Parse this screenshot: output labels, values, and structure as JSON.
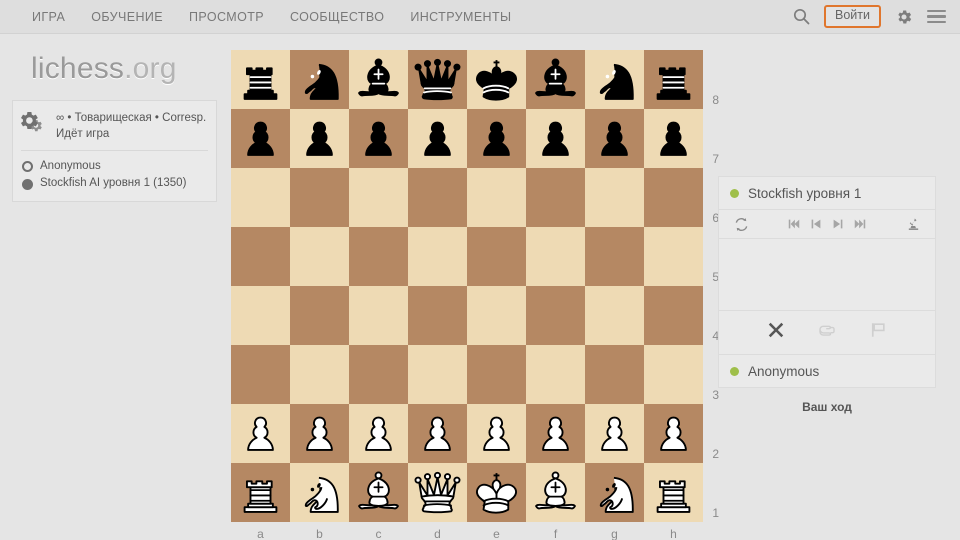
{
  "header": {
    "nav": [
      {
        "label": "ИГРА",
        "name": "nav-play"
      },
      {
        "label": "ОБУЧЕНИЕ",
        "name": "nav-learn"
      },
      {
        "label": "ПРОСМОТР",
        "name": "nav-watch"
      },
      {
        "label": "СООБЩЕСТВО",
        "name": "nav-community"
      },
      {
        "label": "ИНСТРУМЕНТЫ",
        "name": "nav-tools"
      }
    ],
    "search_icon": "search-icon",
    "signin_label": "Войти",
    "gear_icon": "gear-icon",
    "menu_icon": "hamburger-menu-icon",
    "accent_color": "#e0762d",
    "background": "#dedede"
  },
  "logo": {
    "text_main": "lichess",
    "text_dim": ".org"
  },
  "game_info": {
    "gears_icon": "gears-icon",
    "meta_line": "∞ • Товарищеская • Corresp.",
    "status_line": "Идёт игра",
    "players": [
      {
        "name": "Anonymous",
        "color": "white"
      },
      {
        "name": "Stockfish AI уровня 1 (1350)",
        "color": "black"
      }
    ]
  },
  "board": {
    "light_color": "#eedab4",
    "dark_color": "#b58863",
    "files": [
      "a",
      "b",
      "c",
      "d",
      "e",
      "f",
      "g",
      "h"
    ],
    "ranks": [
      "8",
      "7",
      "6",
      "5",
      "4",
      "3",
      "2",
      "1"
    ],
    "orientation": "white",
    "position": [
      [
        "r",
        "n",
        "b",
        "q",
        "k",
        "b",
        "n",
        "r"
      ],
      [
        "p",
        "p",
        "p",
        "p",
        "p",
        "p",
        "p",
        "p"
      ],
      [
        "",
        "",
        "",
        "",
        "",
        "",
        "",
        ""
      ],
      [
        "",
        "",
        "",
        "",
        "",
        "",
        "",
        ""
      ],
      [
        "",
        "",
        "",
        "",
        "",
        "",
        "",
        ""
      ],
      [
        "",
        "",
        "",
        "",
        "",
        "",
        "",
        ""
      ],
      [
        "P",
        "P",
        "P",
        "P",
        "P",
        "P",
        "P",
        "P"
      ],
      [
        "R",
        "N",
        "B",
        "Q",
        "K",
        "B",
        "N",
        "R"
      ]
    ]
  },
  "right_panel": {
    "top_player": {
      "name": "Stockfish уровня 1",
      "status_color": "#9fbf4a"
    },
    "bottom_player": {
      "name": "Anonymous",
      "status_color": "#9fbf4a"
    },
    "controls": [
      {
        "name": "flip-board-icon",
        "glyph": "flip"
      },
      {
        "name": "first-move-icon",
        "glyph": "first"
      },
      {
        "name": "prev-move-icon",
        "glyph": "prev"
      },
      {
        "name": "next-move-icon",
        "glyph": "next"
      },
      {
        "name": "last-move-icon",
        "glyph": "last"
      },
      {
        "name": "analysis-board-icon",
        "glyph": "microscope"
      }
    ],
    "actions": [
      {
        "name": "abort-game-icon",
        "glyph": "cross",
        "enabled": true
      },
      {
        "name": "offer-draw-icon",
        "glyph": "handshake",
        "enabled": false
      },
      {
        "name": "resign-icon",
        "glyph": "flag",
        "enabled": false
      }
    ],
    "moves": []
  },
  "status": {
    "your_turn": "Ваш ход"
  }
}
